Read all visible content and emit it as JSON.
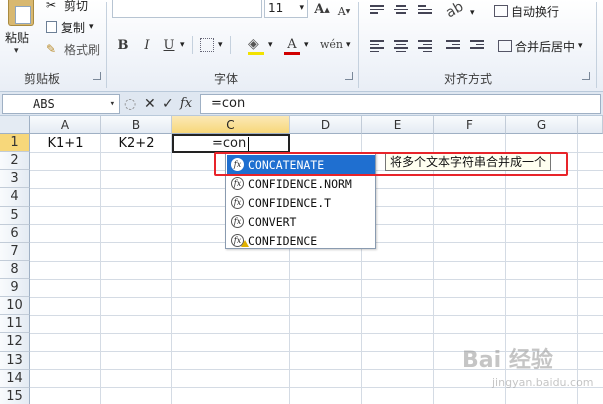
{
  "ribbon": {
    "clipboard": {
      "paste_label": "粘贴",
      "cut_label": "剪切",
      "copy_label": "复制",
      "format_painter_label": "格式刷",
      "group_label": "剪贴板"
    },
    "font": {
      "font_size": "11",
      "bold": "B",
      "italic": "I",
      "underline": "U",
      "group_label": "字体"
    },
    "alignment": {
      "wrap_text_label": "自动换行",
      "merge_center_label": "合并后居中",
      "group_label": "对齐方式"
    }
  },
  "formula_bar": {
    "name_box": "ABS",
    "cancel_icon": "✕",
    "enter_icon": "✓",
    "fx_label": "fx",
    "formula": "=con"
  },
  "sheet": {
    "columns": [
      "A",
      "B",
      "C",
      "D",
      "E",
      "F",
      "G"
    ],
    "rows": [
      "1",
      "2",
      "3",
      "4",
      "5",
      "6",
      "7",
      "8",
      "9",
      "10",
      "11",
      "12",
      "13",
      "14",
      "15"
    ],
    "cells": {
      "A1": "K1+1",
      "B1": "K2+2",
      "C1": "=con"
    }
  },
  "autocomplete": {
    "items": [
      {
        "name": "CONCATENATE"
      },
      {
        "name": "CONFIDENCE.NORM"
      },
      {
        "name": "CONFIDENCE.T"
      },
      {
        "name": "CONVERT"
      },
      {
        "name": "CONFIDENCE"
      }
    ],
    "tooltip": "将多个文本字符串合并成一个"
  },
  "watermark": {
    "brand": "Bai 经验",
    "url": "jingyan.baidu.com"
  },
  "colors": {
    "selection": "#1f6fd0",
    "highlight_box": "#e8242a",
    "active_header": "#f7d77a"
  }
}
